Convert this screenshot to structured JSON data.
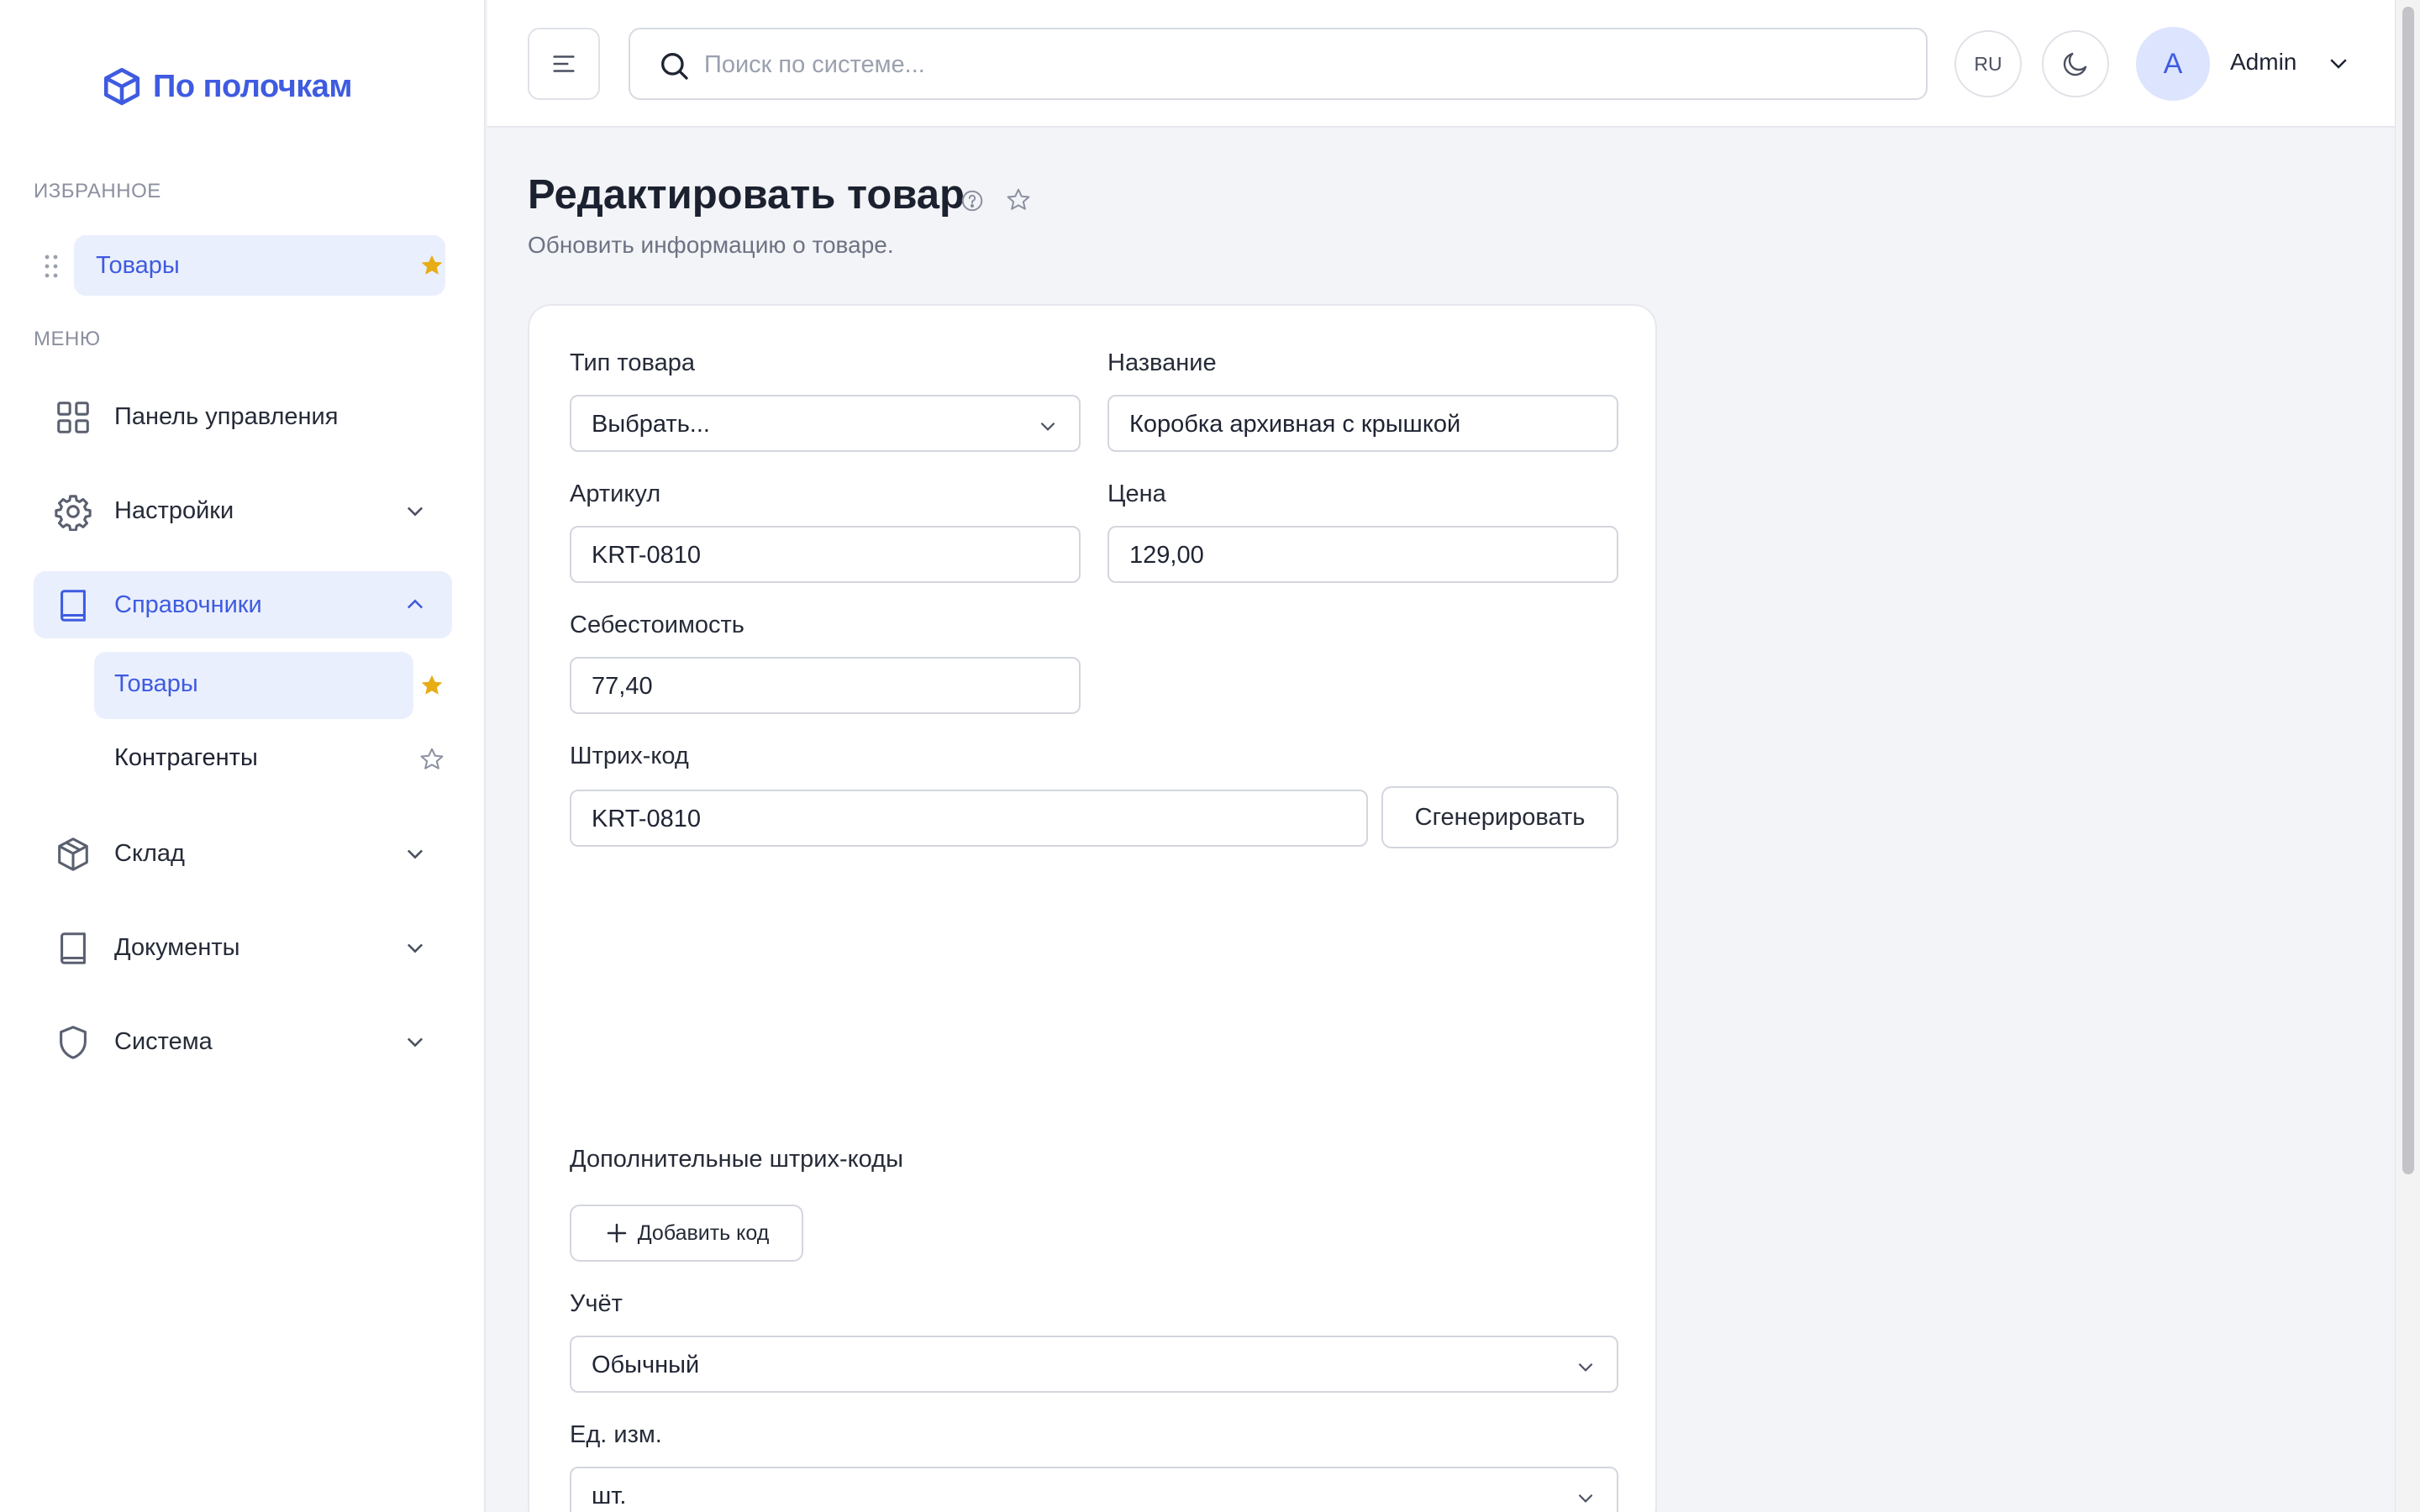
{
  "app": {
    "logo_text": "По полочкам"
  },
  "sidebar": {
    "favorites_label": "ИЗБРАННОЕ",
    "favorites": [
      {
        "label": "Товары",
        "starred": true
      }
    ],
    "menu_label": "МЕНЮ",
    "items": [
      {
        "label": "Панель управления",
        "icon": "grid-icon"
      },
      {
        "label": "Настройки",
        "icon": "gear-icon"
      },
      {
        "label": "Справочники",
        "icon": "book-icon",
        "expanded": true,
        "children": [
          {
            "label": "Товары",
            "active": true,
            "starred": true
          },
          {
            "label": "Контрагенты",
            "starred": false
          }
        ]
      },
      {
        "label": "Склад",
        "icon": "box-icon"
      },
      {
        "label": "Документы",
        "icon": "book-icon"
      },
      {
        "label": "Система",
        "icon": "shield-icon"
      }
    ]
  },
  "topbar": {
    "search_placeholder": "Поиск по системе...",
    "lang": "RU",
    "avatar_initial": "A",
    "user_name": "Admin"
  },
  "page": {
    "title": "Редактировать товар",
    "subtitle": "Обновить информацию о товаре."
  },
  "form": {
    "type_label": "Тип товара",
    "type_value": "Выбрать...",
    "name_label": "Название",
    "name_value": "Коробка архивная с крышкой",
    "sku_label": "Артикул",
    "sku_value": "KRT-0810",
    "price_label": "Цена",
    "price_value": "129,00",
    "cost_label": "Себестоимость",
    "cost_value": "77,40",
    "barcode_label": "Штрих-код",
    "barcode_value": "KRT-0810",
    "generate_label": "Сгенерировать",
    "extra_barcodes_label": "Дополнительные штрих-коды",
    "add_code_label": "Добавить код",
    "accounting_label": "Учёт",
    "accounting_value": "Обычный",
    "unit_label": "Ед. изм.",
    "unit_value": "шт."
  },
  "colors": {
    "accent": "#3f5be0",
    "accent_bg": "#eaeffd",
    "star": "#e6ad16"
  }
}
